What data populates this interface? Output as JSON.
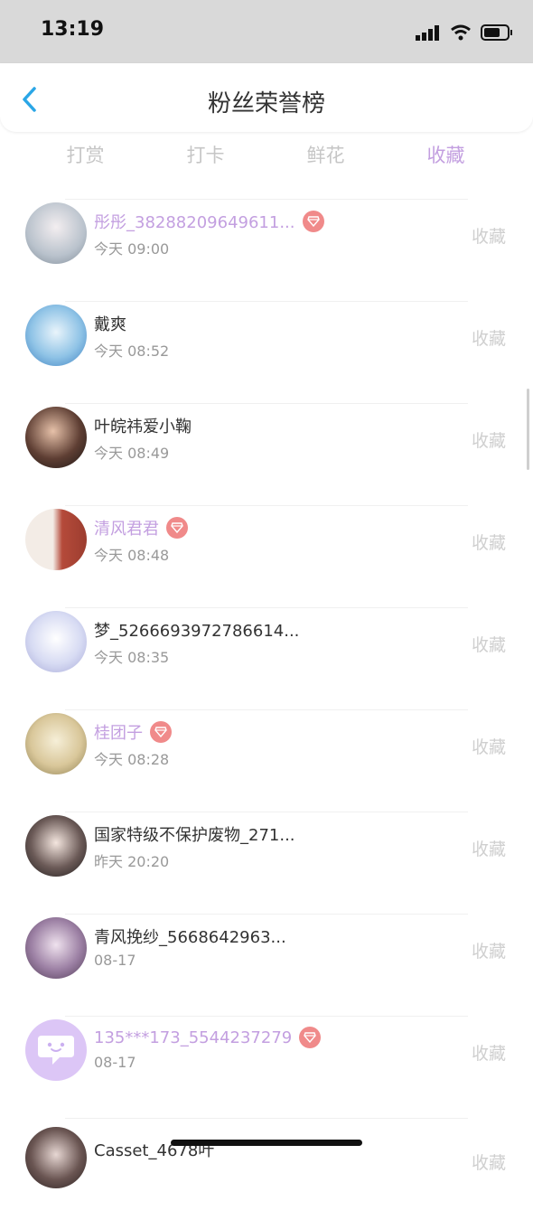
{
  "status_bar": {
    "time": "13:19"
  },
  "header": {
    "title": "粉丝荣誉榜"
  },
  "tabs": [
    {
      "label": "打赏",
      "active": false
    },
    {
      "label": "打卡",
      "active": false
    },
    {
      "label": "鲜花",
      "active": false
    },
    {
      "label": "收藏",
      "active": true
    }
  ],
  "rows": [
    {
      "name": "彤彤_38288209649611...",
      "time": "今天 09:00",
      "vip": true,
      "action": "收藏"
    },
    {
      "name": "戴爽",
      "time": "今天 08:52",
      "vip": false,
      "action": "收藏"
    },
    {
      "name": "叶皖祎爱小鞠",
      "time": "今天 08:49",
      "vip": false,
      "action": "收藏"
    },
    {
      "name": "清风君君",
      "time": "今天 08:48",
      "vip": true,
      "action": "收藏"
    },
    {
      "name": "梦_5266693972786614...",
      "time": "今天 08:35",
      "vip": false,
      "action": "收藏"
    },
    {
      "name": "桂团子",
      "time": "今天 08:28",
      "vip": true,
      "action": "收藏"
    },
    {
      "name": "国家特级不保护废物_271...",
      "time": "昨天 20:20",
      "vip": false,
      "action": "收藏"
    },
    {
      "name": "青风挽纱_5668642963...",
      "time": "08-17",
      "vip": false,
      "action": "收藏"
    },
    {
      "name": "135***173_5544237279",
      "time": "08-17",
      "vip": true,
      "action": "收藏"
    },
    {
      "name": "Casset_4678叶",
      "time": "",
      "vip": false,
      "action": "收藏"
    }
  ],
  "colors": {
    "accent": "#c39fe0",
    "badge": "#f08a8a",
    "muted": "#cfcfcf"
  }
}
